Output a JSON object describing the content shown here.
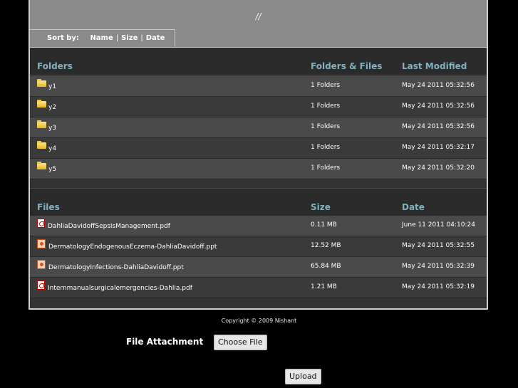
{
  "banner": {
    "path": "//",
    "sort_label": "Sort by:",
    "sort_name": "Name",
    "sort_size": "Size",
    "sort_date": "Date"
  },
  "folders": {
    "headers": [
      "Folders",
      "Folders & Files",
      "Last Modified"
    ],
    "rows": [
      {
        "name": "y1",
        "count": "1 Folders",
        "modified": "May 24 2011 05:32:56"
      },
      {
        "name": "y2",
        "count": "1 Folders",
        "modified": "May 24 2011 05:32:56"
      },
      {
        "name": "y3",
        "count": "1 Folders",
        "modified": "May 24 2011 05:32:56"
      },
      {
        "name": "y4",
        "count": "1 Folders",
        "modified": "May 24 2011 05:32:17"
      },
      {
        "name": "y5",
        "count": "1 Folders",
        "modified": "May 24 2011 05:32:20"
      }
    ]
  },
  "files": {
    "headers": [
      "Files",
      "Size",
      "Date"
    ],
    "rows": [
      {
        "name": "DahliaDavidoffSepsisManagement.pdf",
        "size": "0.11 MB",
        "date": "June 11 2011 04:10:24",
        "icon": "pdf-icon"
      },
      {
        "name": "DermatologyEndogenousEczema-DahliaDavidoff.ppt",
        "size": "12.52 MB",
        "date": "May 24 2011 05:32:55",
        "icon": "ppt-icon"
      },
      {
        "name": "DermatologyInfections-DahliaDavidoff.ppt",
        "size": "65.84 MB",
        "date": "May 24 2011 05:32:39",
        "icon": "ppt-icon"
      },
      {
        "name": "Internmanualsurgicalemergencies-Dahlia.pdf",
        "size": "1.21 MB",
        "date": "May 24 2011 05:32:19",
        "icon": "pdf-icon"
      }
    ]
  },
  "footer": {
    "copyright": "Copyright © 2009 Nishant",
    "attachment_label": "File Attachment",
    "choose_file": "Choose File",
    "upload": "Upload"
  },
  "colors": {
    "header_text": "#7fb2c0",
    "banner": "#8a8a8a",
    "panel": "#333333"
  }
}
